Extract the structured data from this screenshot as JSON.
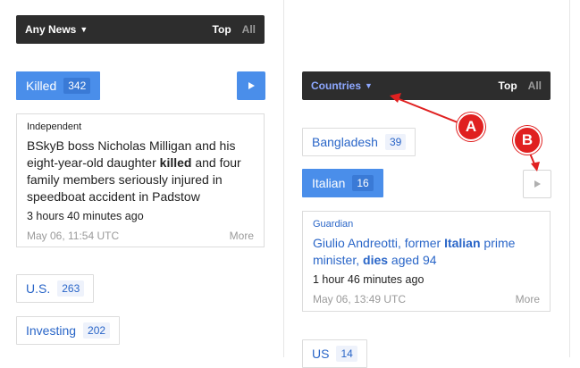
{
  "left_column": {
    "filter_bar": {
      "selector_label": "Any News",
      "top_label": "Top",
      "all_label": "All"
    },
    "topic_killed": {
      "label": "Killed",
      "count": "342"
    },
    "story": {
      "source": "Independent",
      "headline_pre": "BSkyB boss Nicholas Milligan and his eight-year-old daughter ",
      "headline_bold": "killed",
      "headline_post": " and four family members seriously injured in speedboat accident in Padstow",
      "ago": "3 hours 40 minutes ago",
      "date": "May 06, 11:54 UTC",
      "more_label": "More"
    },
    "topic_us": {
      "label": "U.S.",
      "count": "263"
    },
    "topic_investing": {
      "label": "Investing",
      "count": "202"
    }
  },
  "right_column": {
    "filter_bar": {
      "selector_label": "Countries",
      "top_label": "Top",
      "all_label": "All"
    },
    "country_bangladesh": {
      "label": "Bangladesh",
      "count": "39"
    },
    "country_italian": {
      "label": "Italian",
      "count": "16"
    },
    "story": {
      "source": "Guardian",
      "headline_pre": "Giulio Andreotti, former ",
      "headline_bold1": "Italian",
      "headline_mid": " prime minister, ",
      "headline_bold2": "dies",
      "headline_post": " aged 94",
      "ago": "1 hour 46 minutes ago",
      "date": "May 06, 13:49 UTC",
      "more_label": "More"
    },
    "country_us": {
      "label": "US",
      "count": "14"
    }
  },
  "annotations": {
    "a_label": "A",
    "b_label": "B"
  },
  "colors": {
    "accent": "#4a8eea",
    "bar": "#2d2d2d",
    "link": "#2a66c8",
    "annotation": "#e02020"
  },
  "icons": [
    "chevron-down-icon",
    "play-icon"
  ]
}
